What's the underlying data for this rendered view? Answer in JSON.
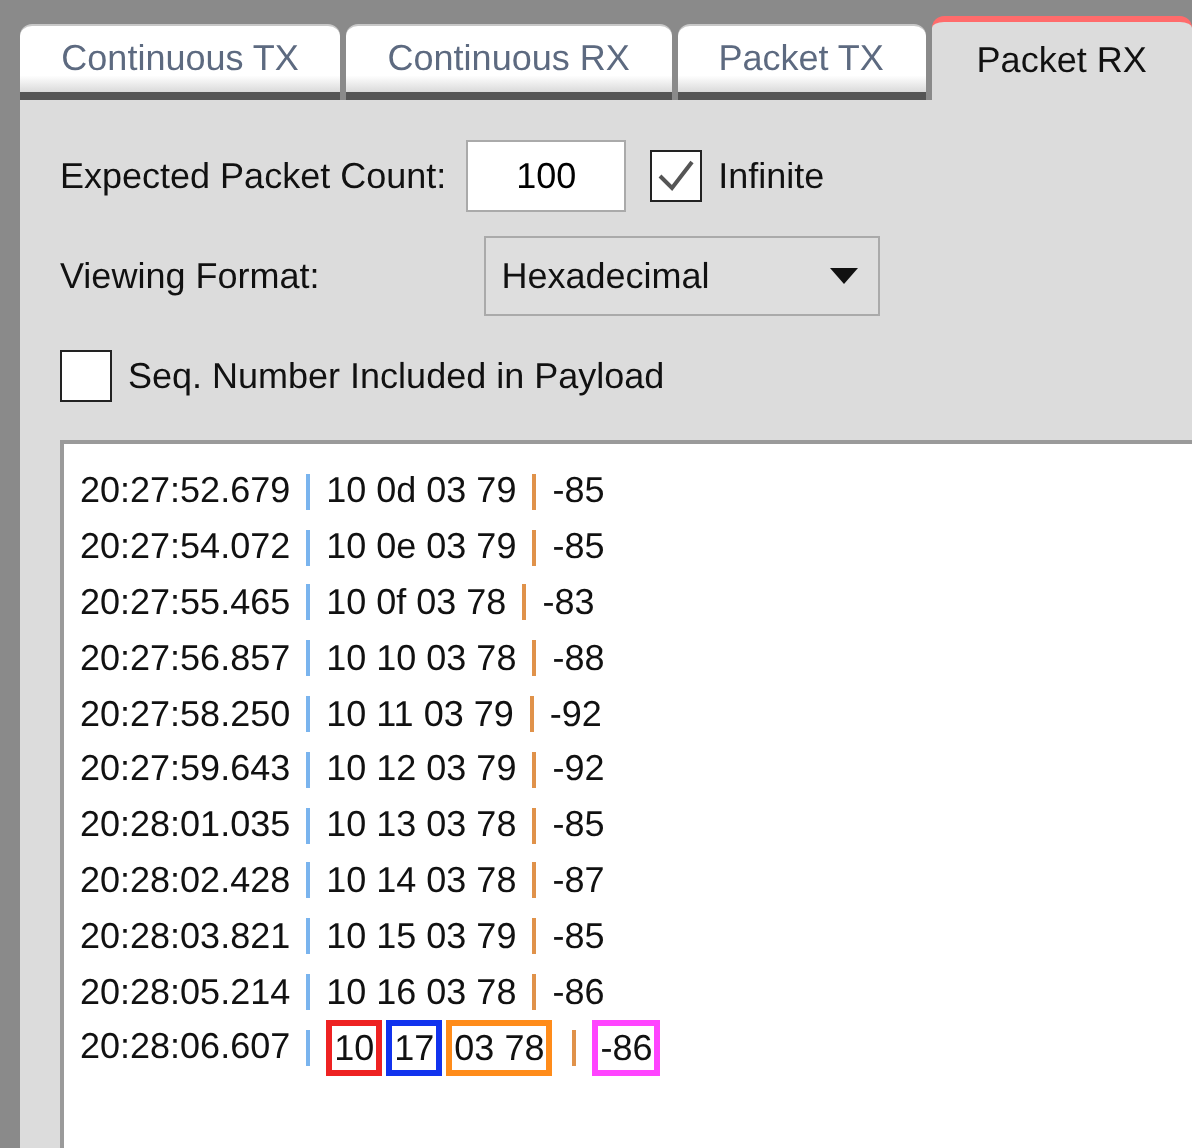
{
  "tabs": [
    {
      "label": "Continuous TX",
      "selected": false
    },
    {
      "label": "Continuous RX",
      "selected": false
    },
    {
      "label": "Packet TX",
      "selected": false
    },
    {
      "label": "Packet RX",
      "selected": true
    }
  ],
  "expected_count": {
    "label": "Expected Packet Count:",
    "value": "100"
  },
  "infinite": {
    "label": "Infinite",
    "checked": true
  },
  "viewing_format": {
    "label": "Viewing Format:",
    "value": "Hexadecimal"
  },
  "seq_number": {
    "label": "Seq. Number Included in Payload",
    "checked": false
  },
  "log": [
    {
      "kind": "plain",
      "time": "20:27:52.679",
      "payload": "10 0d 03 79",
      "rssi": "-85"
    },
    {
      "kind": "plain",
      "time": "20:27:54.072",
      "payload": "10 0e 03 79",
      "rssi": "-85"
    },
    {
      "kind": "plain",
      "time": "20:27:55.465",
      "payload": "10 0f 03 78",
      "rssi": "-83"
    },
    {
      "kind": "plain",
      "time": "20:27:56.857",
      "payload": "10 10 03 78",
      "rssi": "-88"
    },
    {
      "kind": "plain",
      "time": "20:27:58.250",
      "payload": "10 11 03 79",
      "rssi": "-92"
    },
    {
      "kind": "plain",
      "time": "20:27:59.643",
      "payload": "10 12 03 79",
      "rssi": "-92"
    },
    {
      "kind": "plain",
      "time": "20:28:01.035",
      "payload": "10 13 03 78",
      "rssi": "-85"
    },
    {
      "kind": "plain",
      "time": "20:28:02.428",
      "payload": "10 14 03 78",
      "rssi": "-87"
    },
    {
      "kind": "plain",
      "time": "20:28:03.821",
      "payload": "10 15 03 79",
      "rssi": "-85"
    },
    {
      "kind": "plain",
      "time": "20:28:05.214",
      "payload": "10 16 03 78",
      "rssi": "-86"
    },
    {
      "kind": "annotated",
      "time": "20:28:06.607",
      "parts": [
        {
          "text": "10",
          "color": "#ee2222"
        },
        {
          "text": "17",
          "color": "#1133ee"
        },
        {
          "text": "03 78",
          "color": "#ff8c1a"
        }
      ],
      "rssi": {
        "text": "-86",
        "color": "#ff44ff"
      }
    }
  ]
}
